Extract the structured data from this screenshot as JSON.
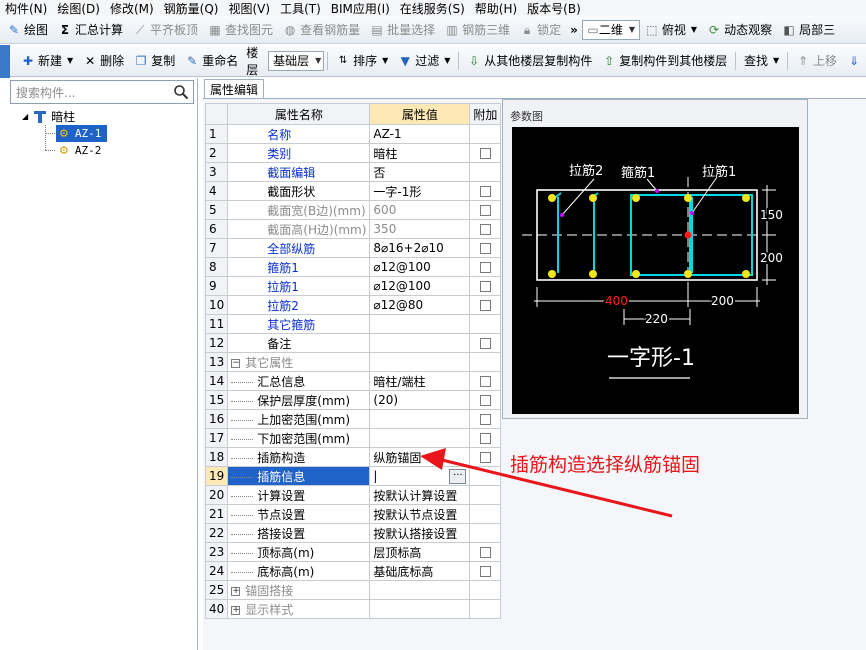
{
  "menu": [
    "构件(N)",
    "绘图(D)",
    "修改(M)",
    "钢筋量(Q)",
    "视图(V)",
    "工具(T)",
    "BIM应用(I)",
    "在线服务(S)",
    "帮助(H)",
    "版本号(B)"
  ],
  "toolbar1": {
    "draw": "绘图",
    "sum_calc": "汇总计算",
    "align_top": "平齐板顶",
    "find_element": "查找图元",
    "view_rebar_qty": "查看钢筋量",
    "batch_select": "批量选择",
    "rebar_3d": "钢筋三维",
    "lock": "锁定",
    "view_mode": "二维",
    "top_view": "俯视",
    "dynamic_observe": "动态观察",
    "local_3d": "局部三"
  },
  "toolbar2": {
    "new": "新建",
    "delete": "删除",
    "copy": "复制",
    "rename": "重命名",
    "floor_label": "楼层",
    "floor_value": "基础层",
    "sort": "排序",
    "filter": "过滤",
    "copy_from_floor": "从其他楼层复制构件",
    "copy_to_floor": "复制构件到其他楼层",
    "find": "查找",
    "move_up": "上移"
  },
  "left_panel": {
    "search_placeholder": "搜索构件...",
    "tree_root": "暗柱",
    "tree_items": [
      "AZ-1",
      "AZ-2"
    ]
  },
  "props": {
    "tab": "属性编辑",
    "headers": [
      "属性名称",
      "属性值",
      "附加"
    ],
    "rows": [
      {
        "num": "1",
        "name": "名称",
        "value": "AZ-1"
      },
      {
        "num": "2",
        "name": "类别",
        "value": "暗柱"
      },
      {
        "num": "3",
        "name": "截面编辑",
        "value": "否"
      },
      {
        "num": "4",
        "name": "截面形状",
        "value": "一字-1形"
      },
      {
        "num": "5",
        "name": "截面宽(B边)(mm)",
        "value": "600"
      },
      {
        "num": "6",
        "name": "截面高(H边)(mm)",
        "value": "350"
      },
      {
        "num": "7",
        "name": "全部纵筋",
        "value": "8⌀16+2⌀10"
      },
      {
        "num": "8",
        "name": "箍筋1",
        "value": "⌀12@100"
      },
      {
        "num": "9",
        "name": "拉筋1",
        "value": "⌀12@100"
      },
      {
        "num": "10",
        "name": "拉筋2",
        "value": "⌀12@80"
      },
      {
        "num": "11",
        "name": "其它箍筋",
        "value": ""
      },
      {
        "num": "12",
        "name": "备注",
        "value": ""
      },
      {
        "num": "13",
        "name": "其它属性",
        "value": ""
      },
      {
        "num": "14",
        "name": "汇总信息",
        "value": "暗柱/端柱"
      },
      {
        "num": "15",
        "name": "保护层厚度(mm)",
        "value": "(20)"
      },
      {
        "num": "16",
        "name": "上加密范围(mm)",
        "value": ""
      },
      {
        "num": "17",
        "name": "下加密范围(mm)",
        "value": ""
      },
      {
        "num": "18",
        "name": "插筋构造",
        "value": "纵筋锚固"
      },
      {
        "num": "19",
        "name": "插筋信息",
        "value": ""
      },
      {
        "num": "20",
        "name": "计算设置",
        "value": "按默认计算设置"
      },
      {
        "num": "21",
        "name": "节点设置",
        "value": "按默认节点设置"
      },
      {
        "num": "22",
        "name": "搭接设置",
        "value": "按默认搭接设置"
      },
      {
        "num": "23",
        "name": "顶标高(m)",
        "value": "层顶标高"
      },
      {
        "num": "24",
        "name": "底标高(m)",
        "value": "基础底标高"
      },
      {
        "num": "25",
        "name": "锚固搭接",
        "value": ""
      },
      {
        "num": "40",
        "name": "显示样式",
        "value": ""
      }
    ]
  },
  "param_diagram": {
    "title": "参数图",
    "labels": {
      "tie2": "拉筋2",
      "stirrup1": "箍筋1",
      "tie1": "拉筋1",
      "dim_400": "400",
      "dim_200_bottom": "200",
      "dim_220": "220",
      "dim_150": "150",
      "dim_200_right": "200",
      "shape_name": "一字形-1"
    },
    "colors": {
      "outline": "#ffffff",
      "rebar": "#00d8e8",
      "bar": "#f2e51b",
      "center": "#ff1b1b",
      "dim_red": "#ff2020"
    }
  },
  "annotation": "插筋构造选择纵筋锚固"
}
